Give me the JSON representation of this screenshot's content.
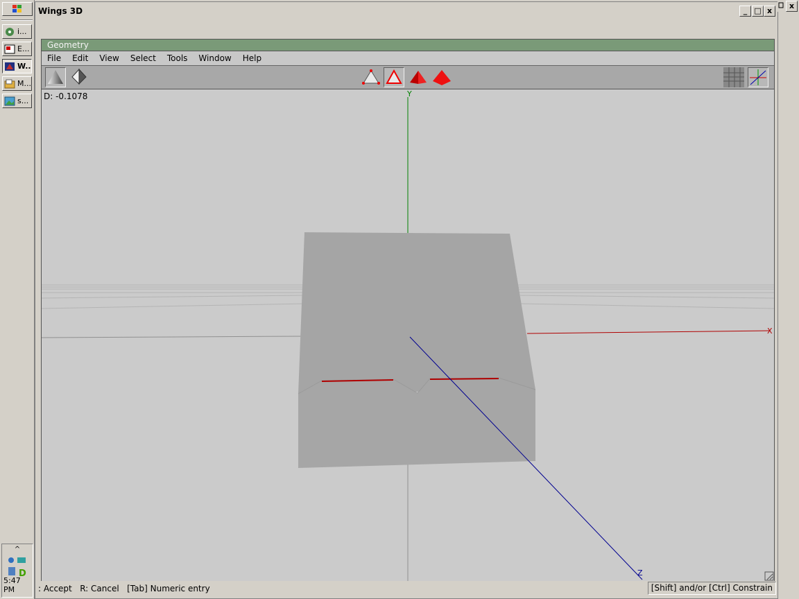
{
  "taskbar": {
    "items": [
      {
        "label": "i...",
        "icon": "media-player-icon"
      },
      {
        "label": "E...",
        "icon": "video-editor-icon"
      },
      {
        "label": "W...",
        "icon": "wings3d-icon",
        "active": true
      },
      {
        "label": "M...",
        "icon": "file-manager-icon"
      },
      {
        "label": "s...",
        "icon": "image-viewer-icon"
      }
    ],
    "tray_up": "^",
    "clock": "5:47 PM"
  },
  "window": {
    "title": "Wings 3D",
    "min": "_",
    "max": "□",
    "close": "x"
  },
  "outer_close": "x",
  "geometry": {
    "title": "Geometry",
    "menus": [
      "File",
      "Edit",
      "View",
      "Select",
      "Tools",
      "Window",
      "Help"
    ]
  },
  "viewport": {
    "distance": "D: -0.1078",
    "axis_y": "Y",
    "axis_x": "X",
    "axis_z": "Z"
  },
  "status": {
    "left": ": Accept   R: Cancel   [Tab] Numeric entry",
    "right": "[Shift] and/or [Ctrl] Constrain"
  },
  "colors": {
    "title_green": "#7a9a78",
    "axis_x": "#b00000",
    "axis_y": "#008000",
    "axis_z": "#000090",
    "selection_red": "#e00000"
  }
}
